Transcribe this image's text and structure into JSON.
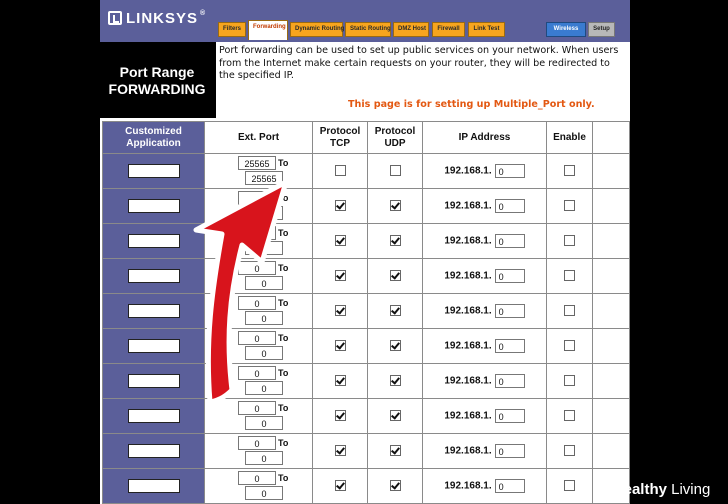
{
  "header": {
    "logo_text": "LINKSYS",
    "logo_mark": "®",
    "tabs": [
      {
        "label": "Filters",
        "state": "normal"
      },
      {
        "label": "Forwarding",
        "state": "active"
      },
      {
        "label": "Dynamic Routing",
        "state": "normal"
      },
      {
        "label": "Static Routing",
        "state": "normal"
      },
      {
        "label": "DMZ Host",
        "state": "normal"
      },
      {
        "label": "Firewall",
        "state": "normal"
      },
      {
        "label": "Link Test",
        "state": "normal"
      },
      {
        "label": "Wireless",
        "state": "blue"
      },
      {
        "label": "Setup",
        "state": "grey"
      }
    ]
  },
  "page": {
    "title_line1": "Port Range",
    "title_line2": "FORWARDING",
    "description": "Port forwarding can be used to set up public services on your network. When users from the Internet make certain requests on your router, they will be redirected to the specified IP.",
    "note": "This page is for setting up Multiple_Port only."
  },
  "table": {
    "columns": [
      "Customized Application",
      "Ext. Port",
      "Protocol TCP",
      "Protocol UDP",
      "IP Address",
      "Enable"
    ],
    "to_label": "To",
    "ip_prefix": "192.168.1.",
    "rows": [
      {
        "port_start": "25565",
        "port_end": "25565",
        "tcp": false,
        "udp": false,
        "ip_last": "0",
        "enable": false
      },
      {
        "port_start": "0",
        "port_end": "0",
        "tcp": true,
        "udp": true,
        "ip_last": "0",
        "enable": false
      },
      {
        "port_start": "0",
        "port_end": "0",
        "tcp": true,
        "udp": true,
        "ip_last": "0",
        "enable": false
      },
      {
        "port_start": "0",
        "port_end": "0",
        "tcp": true,
        "udp": true,
        "ip_last": "0",
        "enable": false
      },
      {
        "port_start": "0",
        "port_end": "0",
        "tcp": true,
        "udp": true,
        "ip_last": "0",
        "enable": false
      },
      {
        "port_start": "0",
        "port_end": "0",
        "tcp": true,
        "udp": true,
        "ip_last": "0",
        "enable": false
      },
      {
        "port_start": "0",
        "port_end": "0",
        "tcp": true,
        "udp": true,
        "ip_last": "0",
        "enable": false
      },
      {
        "port_start": "0",
        "port_end": "0",
        "tcp": true,
        "udp": true,
        "ip_last": "0",
        "enable": false
      },
      {
        "port_start": "0",
        "port_end": "0",
        "tcp": true,
        "udp": true,
        "ip_last": "0",
        "enable": false
      },
      {
        "port_start": "0",
        "port_end": "0",
        "tcp": true,
        "udp": true,
        "ip_last": "0",
        "enable": false
      }
    ]
  },
  "watermark": {
    "plus": "+",
    "brand_bold": "Healthy",
    "brand_thin": " Living"
  },
  "colors": {
    "header_bg": "#5b5f9a",
    "tab_orange": "#f7a51e",
    "note_orange": "#e35812",
    "arrow_red": "#d8141c"
  }
}
